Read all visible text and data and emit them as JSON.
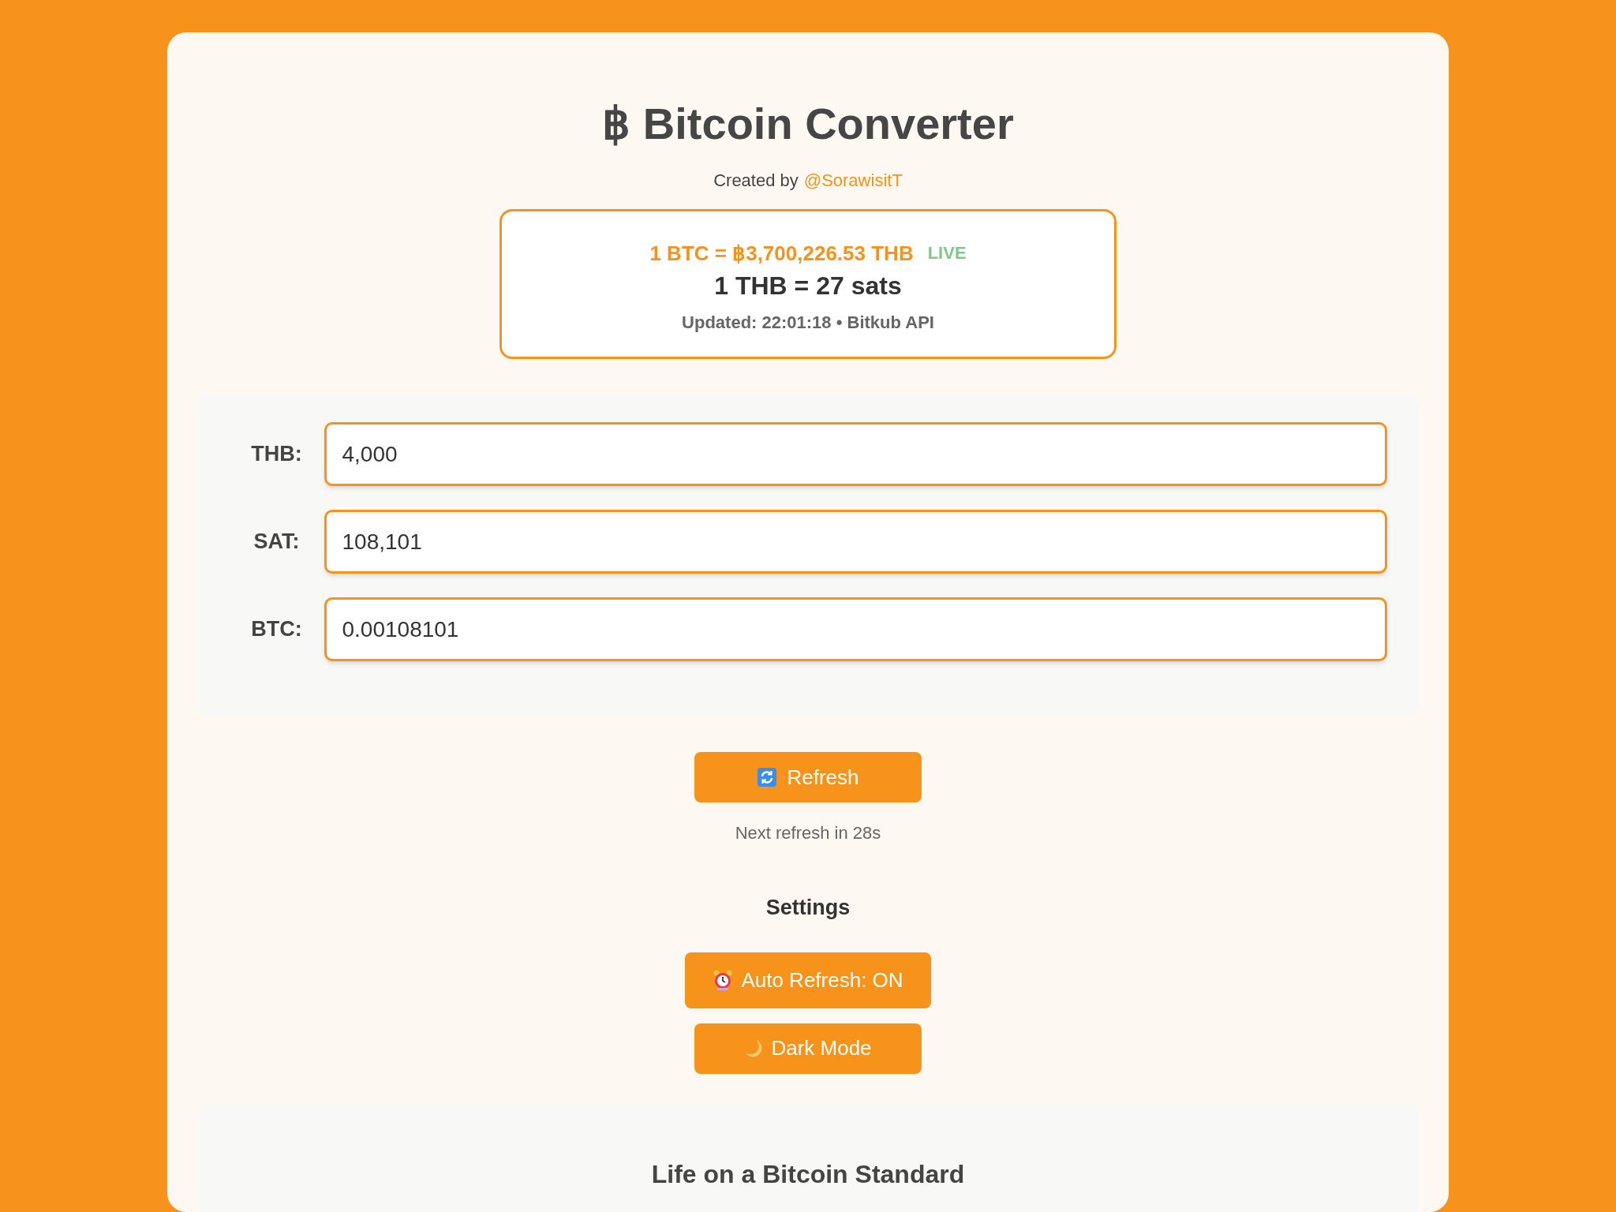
{
  "header": {
    "title": "฿ Bitcoin Converter",
    "credit_prefix": "Created by",
    "credit_link": "@SorawisitT"
  },
  "rate_card": {
    "btc_rate": "1 BTC = ฿3,700,226.53 THB",
    "live_badge": "LIVE",
    "sats_rate": "1 THB = 27 sats",
    "updated": "Updated: 22:01:18 • Bitkub API"
  },
  "converter": {
    "fields": [
      {
        "label": "THB:",
        "value": "4,000"
      },
      {
        "label": "SAT:",
        "value": "108,101"
      },
      {
        "label": "BTC:",
        "value": "0.00108101"
      }
    ]
  },
  "refresh_button": "Refresh",
  "countdown": "Next refresh in 28s",
  "settings": {
    "heading": "Settings",
    "buttons": [
      "Auto Refresh: ON",
      "Dark Mode"
    ]
  },
  "section": {
    "heading": "Life on a Bitcoin Standard"
  }
}
